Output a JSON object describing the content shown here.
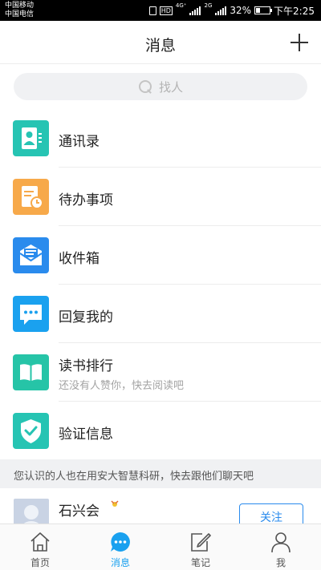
{
  "status_bar": {
    "carrier1": "中国移动",
    "carrier2": "中国电信",
    "hd": "HD",
    "network1": "4G⁺",
    "network2": "2G",
    "battery_percent": "32%",
    "battery_level": 0.32,
    "time": "下午2:25"
  },
  "header": {
    "title": "消息",
    "add_icon": "plus-icon"
  },
  "search": {
    "placeholder": "找人",
    "icon": "search-icon"
  },
  "menu": [
    {
      "label": "通讯录",
      "icon": "contacts-icon",
      "color": "#26c4b3"
    },
    {
      "label": "待办事项",
      "icon": "todo-icon",
      "color": "#f7a94a"
    },
    {
      "label": "收件箱",
      "icon": "inbox-icon",
      "color": "#2a8bed"
    },
    {
      "label": "回复我的",
      "icon": "reply-icon",
      "color": "#1aa1ef"
    },
    {
      "label": "读书排行",
      "sublabel": "还没有人赞你，快去阅读吧",
      "icon": "book-icon",
      "color": "#26c4a7"
    },
    {
      "label": "验证信息",
      "icon": "verify-shield-icon",
      "color": "#26c4b3"
    }
  ],
  "suggestion": {
    "text": "您认识的人也在用安大智慧科研，快去跟他们聊天吧",
    "person": {
      "name": "石兴会",
      "follow_label": "关注"
    }
  },
  "tabbar": {
    "tabs": [
      {
        "label": "首页",
        "icon": "home-icon",
        "active": false
      },
      {
        "label": "消息",
        "icon": "message-icon",
        "active": true
      },
      {
        "label": "笔记",
        "icon": "note-edit-icon",
        "active": false
      },
      {
        "label": "我",
        "icon": "profile-icon",
        "active": false
      }
    ],
    "active_color": "#1aa1ef"
  }
}
